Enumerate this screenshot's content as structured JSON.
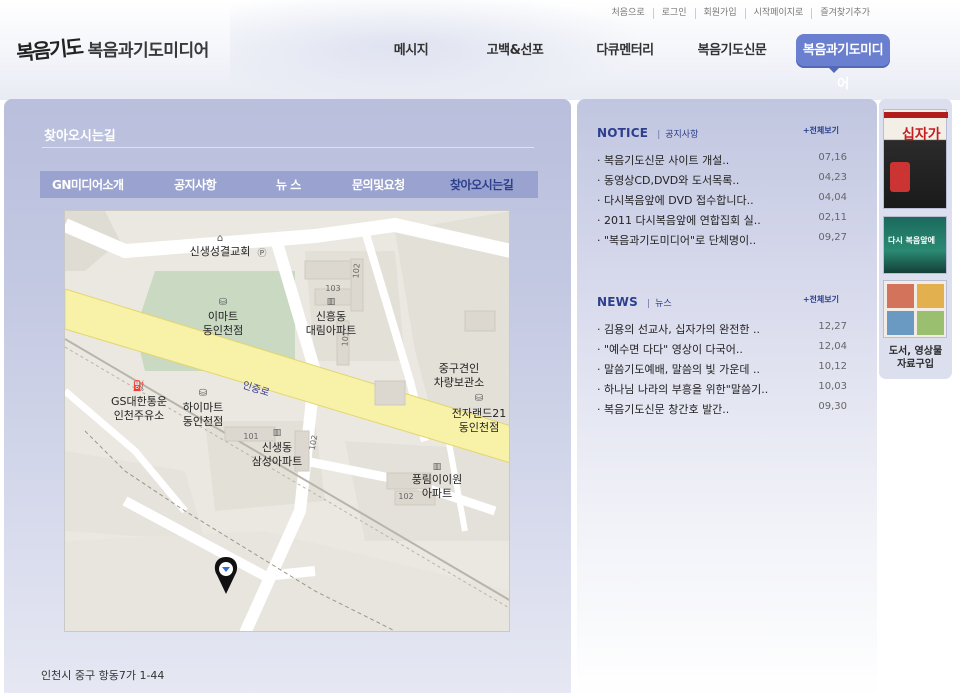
{
  "header": {
    "logo_mark": "복음기도",
    "logo_text": "복음과기도미디어",
    "util_links": [
      "처음으로",
      "로그인",
      "회원가입",
      "시작페이지로",
      "즐겨찾기추가"
    ],
    "nav": [
      "메시지",
      "고백&선포",
      "다큐멘터리",
      "복음기도신문",
      "복음과기도미디어"
    ],
    "nav_active": 4
  },
  "left": {
    "title": "찾아오시는길",
    "subnav": [
      "GN미디어소개",
      "공지사항",
      "뉴 스",
      "문의및요청",
      "찾아오시는길"
    ],
    "subnav_active": 4,
    "address": "인천시 중구 항동7가 1-44",
    "map_labels": {
      "church": "신생성결교회",
      "emart": "이마트\n동인천점",
      "shinheung": "신흥동\n대림아파트",
      "towing": "중구견인\n차량보관소",
      "road": "인중로",
      "gs": "GS대한통운\n인천주유소",
      "himart": "하이마트\n동인천점",
      "samsung": "신생동\n삼성아파트",
      "electroland": "전자랜드21\n동인천점",
      "pungrim": "풍림이이원\n아파트",
      "bldg_101": "101",
      "bldg_102a": "102",
      "bldg_102b": "102",
      "bldg_103": "103",
      "bldg_102c": "102",
      "bldg_101b": "101"
    }
  },
  "notice": {
    "title": "NOTICE",
    "subtitle": "공지사항",
    "more": "+전체보기",
    "items": [
      {
        "title": "· 복음기도신문 사이트 개설..",
        "date": "07,16"
      },
      {
        "title": "· 동영상CD,DVD와 도서목록..",
        "date": "04,23"
      },
      {
        "title": "· 다시복음앞에 DVD 접수합니다..",
        "date": "04,04"
      },
      {
        "title": "· 2011 다시복음앞에 연합집회 실..",
        "date": "02,11"
      },
      {
        "title": "· \"복음과기도미디어\"로 단체명이..",
        "date": "09,27"
      }
    ]
  },
  "news": {
    "title": "NEWS",
    "subtitle": "뉴스",
    "more": "+전체보기",
    "items": [
      {
        "title": "· 김용의 선교사, 십자가의 완전한 ..",
        "date": "12,27"
      },
      {
        "title": "· \"예수면 다다\" 영상이 다국어..",
        "date": "12,04"
      },
      {
        "title": "· 말씀기도예배, 말씀의 빛 가운데 ..",
        "date": "10,12"
      },
      {
        "title": "· 하나님 나라의 부흥을 위한\"말씀기..",
        "date": "10,03"
      },
      {
        "title": "· 복음기도신문 창간호 발간..",
        "date": "09,30"
      }
    ]
  },
  "side": {
    "book1_title": "십자가",
    "book2_title": "다시 복음앞에",
    "caption": "도서, 영상물\n자료구입"
  },
  "colors": {
    "nav_active": "#6b7fd0",
    "board_title": "#2d3f8c",
    "subnav_bg": "#9aa3cf"
  }
}
